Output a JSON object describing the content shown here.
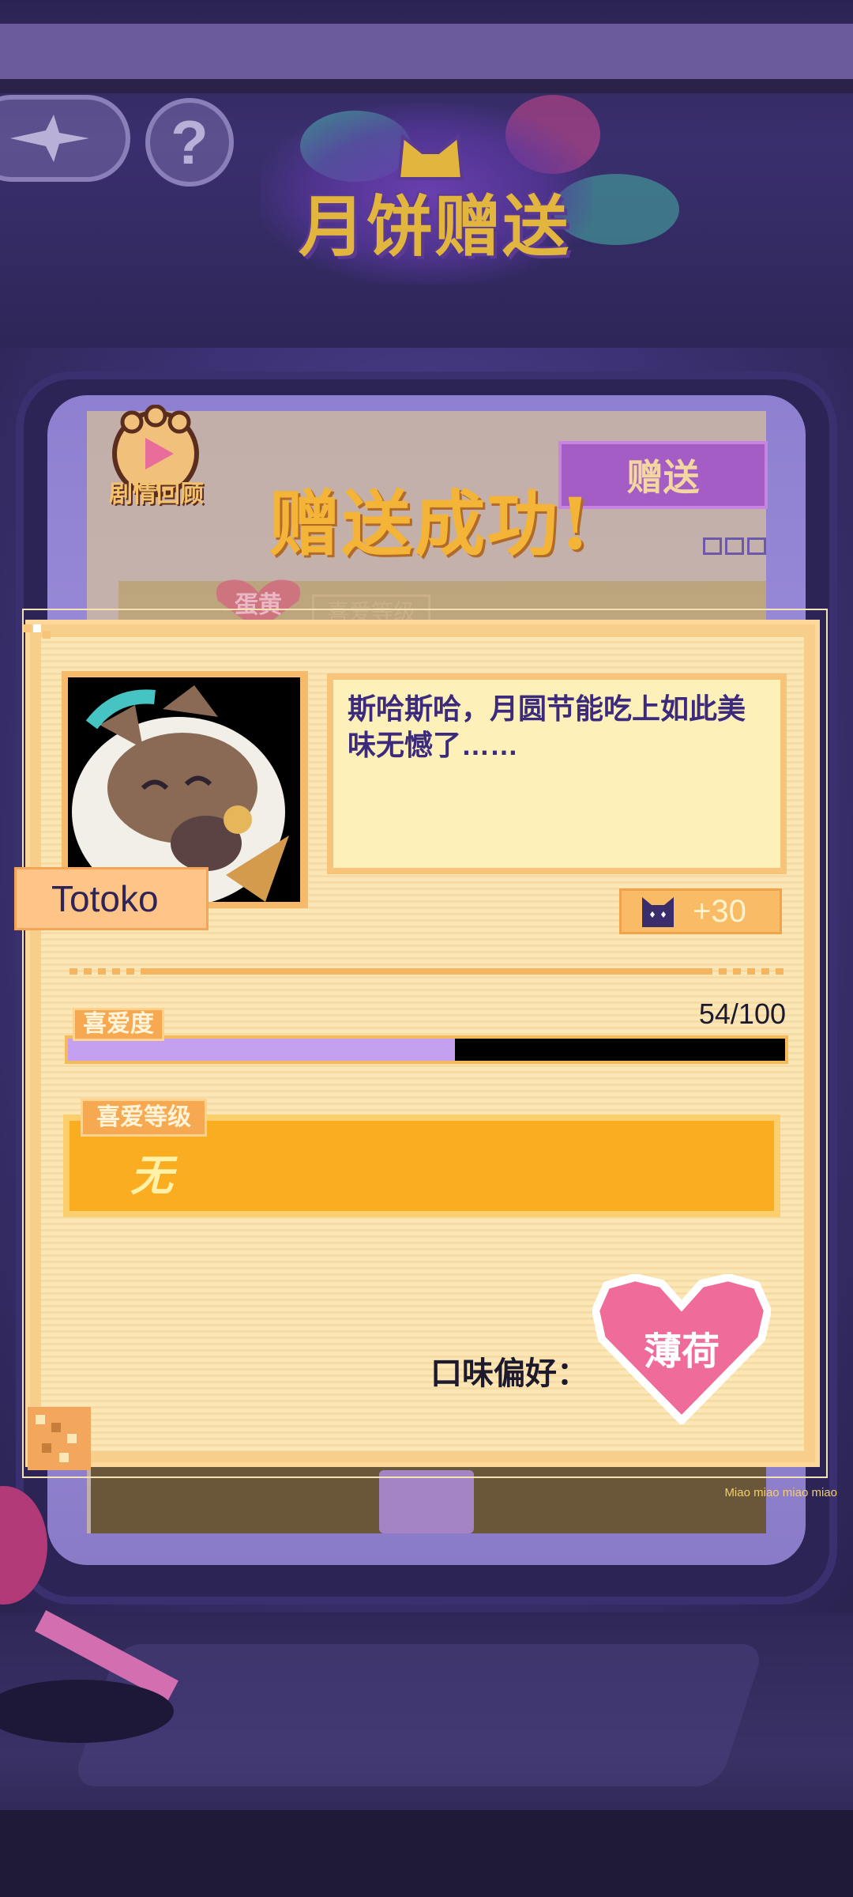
{
  "header": {
    "event_title": "月饼赠送",
    "help_label": "?"
  },
  "background_panel": {
    "story_review_label": "剧情回顾",
    "gift_button_label": "赠送",
    "tab_egg": "蛋黄",
    "tab_level": "喜爱等级",
    "miao_text": "Miao miao miao miao"
  },
  "popup": {
    "title": "赠送成功!",
    "character_name": "Totoko",
    "dialog": "斯哈斯哈，月圆节能吃上如此美味无憾了……",
    "reward": {
      "icon": "cat-face-icon",
      "value": "+30"
    },
    "affection": {
      "label": "喜爱度",
      "current": 54,
      "max": 100,
      "display": "54/100"
    },
    "level": {
      "label": "喜爱等级",
      "value": "无"
    },
    "flavor": {
      "label": "口味偏好：",
      "value": "薄荷"
    }
  },
  "colors": {
    "accent_purple": "#c6a0f0",
    "level_orange": "#fbad22",
    "heart_pink": "#ef6b9a",
    "dialog_text": "#3c2b7c"
  }
}
